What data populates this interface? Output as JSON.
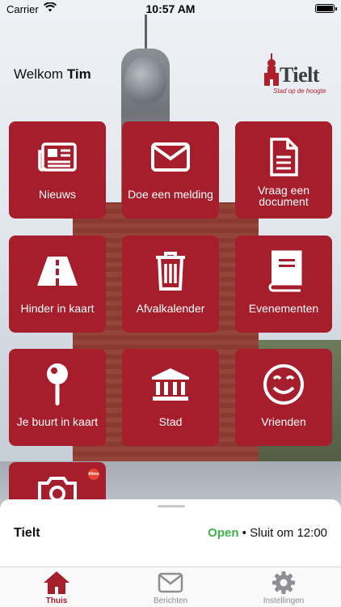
{
  "status_bar": {
    "carrier": "Carrier",
    "time": "10:57 AM"
  },
  "header": {
    "welcome_prefix": "Welkom",
    "user_name": "Tim",
    "logo_word": "Tielt",
    "logo_tagline": "Stad op de hoogte"
  },
  "tiles": [
    {
      "label": "Nieuws",
      "icon": "newspaper-icon"
    },
    {
      "label": "Doe een melding",
      "icon": "envelope-icon"
    },
    {
      "label": "Vraag een document",
      "icon": "document-icon"
    },
    {
      "label": "Hinder in kaart",
      "icon": "road-icon"
    },
    {
      "label": "Afvalkalender",
      "icon": "trash-icon"
    },
    {
      "label": "Evenementen",
      "icon": "book-icon"
    },
    {
      "label": "Je buurt in kaart",
      "icon": "map-pin-icon"
    },
    {
      "label": "Stad",
      "icon": "city-hall-icon"
    },
    {
      "label": "Vrienden",
      "icon": "smiley-icon"
    },
    {
      "label": "",
      "icon": "camera-icon",
      "badge": "tiltme"
    }
  ],
  "sheet": {
    "place": "Tielt",
    "status": "Open",
    "separator": "•",
    "closing": "Sluit om 12:00"
  },
  "tabbar": {
    "items": [
      {
        "label": "Thuis",
        "icon": "home-icon",
        "active": true
      },
      {
        "label": "Berichten",
        "icon": "mail-icon",
        "active": false
      },
      {
        "label": "Instellingen",
        "icon": "gear-icon",
        "active": false
      }
    ]
  },
  "colors": {
    "brand": "#a61d2b",
    "open": "#3bb54a",
    "inactive": "#8e8e93"
  }
}
